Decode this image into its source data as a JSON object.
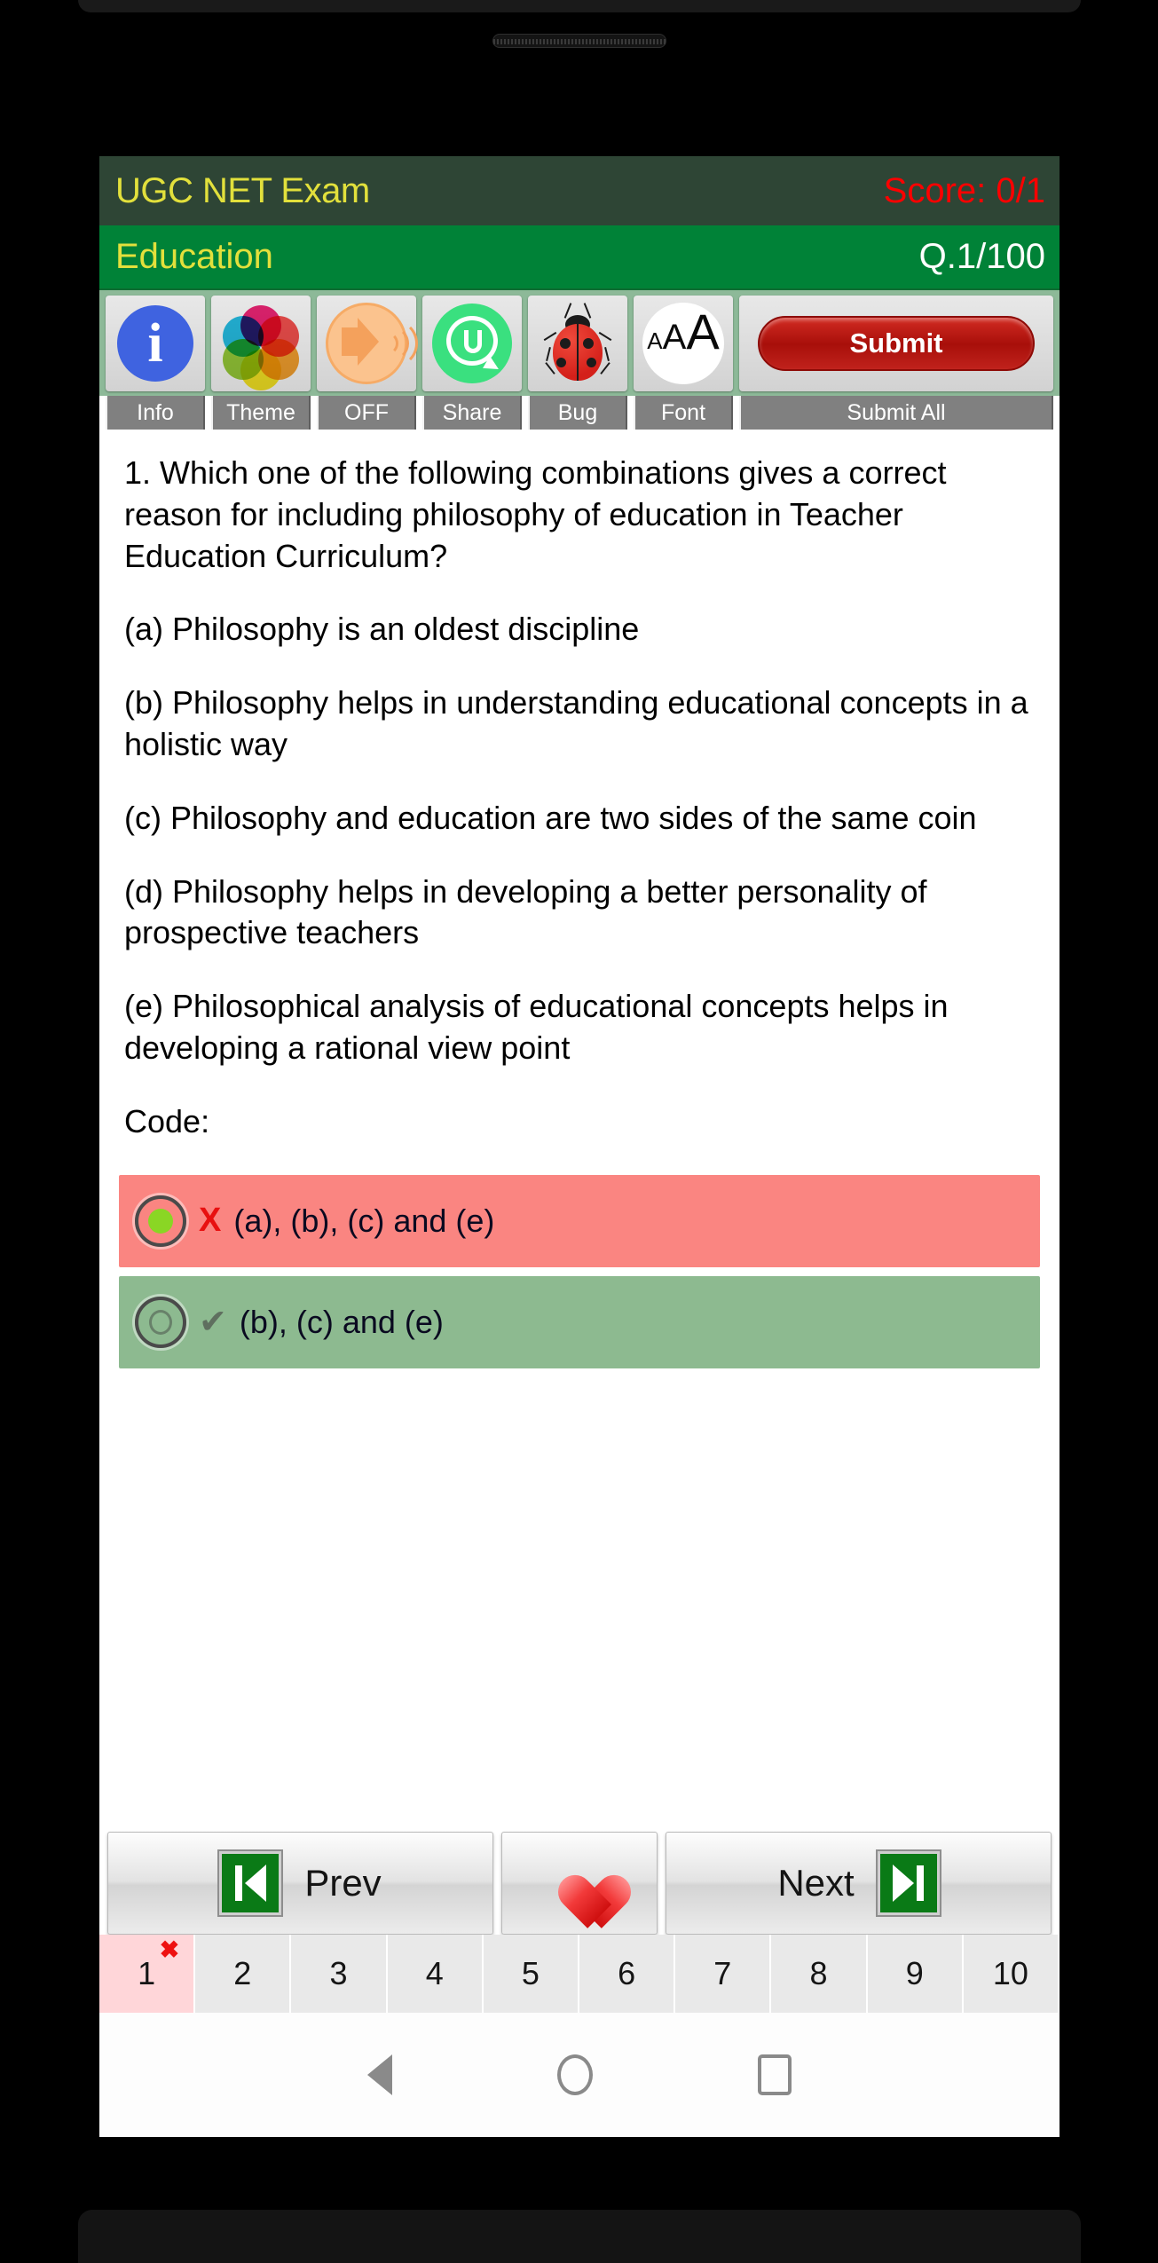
{
  "header": {
    "app_title": "UGC NET Exam",
    "score": "Score: 0/1",
    "score_color": "#fe0000",
    "title_color": "#e2e03c",
    "bar_color": "#2e4535"
  },
  "subject_bar": {
    "subject": "Education",
    "question_counter": "Q.1/100",
    "bar_color": "#008237"
  },
  "toolbar": {
    "items": [
      {
        "icon": "info-icon",
        "label": "Info"
      },
      {
        "icon": "theme-color-wheel-icon",
        "label": "Theme"
      },
      {
        "icon": "speaker-icon",
        "label": "OFF"
      },
      {
        "icon": "whatsapp-share-icon",
        "label": "Share"
      },
      {
        "icon": "ladybug-icon",
        "label": "Bug"
      },
      {
        "icon": "font-size-icon",
        "label": "Font"
      },
      {
        "icon": "submit-button-icon",
        "label": "Submit All",
        "button_text": "Submit"
      }
    ]
  },
  "question": {
    "stem": "1. Which one of the following combinations gives a correct reason for including philosophy of education in Teacher Education Curriculum?",
    "statements": [
      "(a) Philosophy is an oldest discipline",
      "(b) Philosophy helps in understanding educational concepts in a holistic way",
      "(c) Philosophy and education are two sides of the same coin",
      "(d) Philosophy helps in developing a better personality of prospective teachers",
      "(e) Philosophical analysis of educational concepts helps in developing a rational view point"
    ],
    "code_label": "Code:"
  },
  "answers": [
    {
      "text": "(a), (b), (c) and (e)",
      "state": "wrong-selected",
      "mark": "X",
      "mark_color": "#e81010",
      "background": "#fa8581",
      "radio": "filled"
    },
    {
      "text": "(b), (c) and (e)",
      "state": "correct",
      "mark": "✔",
      "mark_color": "#5f6f5f",
      "background": "#8dba90",
      "radio": "empty"
    }
  ],
  "navigation": {
    "prev_label": "Prev",
    "next_label": "Next",
    "favourite_icon": "heart-icon",
    "prev_icon": "skip-previous-icon",
    "next_icon": "skip-next-icon"
  },
  "question_strip": {
    "numbers": [
      "1",
      "2",
      "3",
      "4",
      "5",
      "6",
      "7",
      "8",
      "9",
      "10"
    ],
    "active_index": 0,
    "active_mark": "✖",
    "active_mark_color": "#ee1111",
    "active_background": "#ffd6d9"
  },
  "android_nav": {
    "back": "back-icon",
    "home": "home-icon",
    "recents": "recents-icon"
  }
}
